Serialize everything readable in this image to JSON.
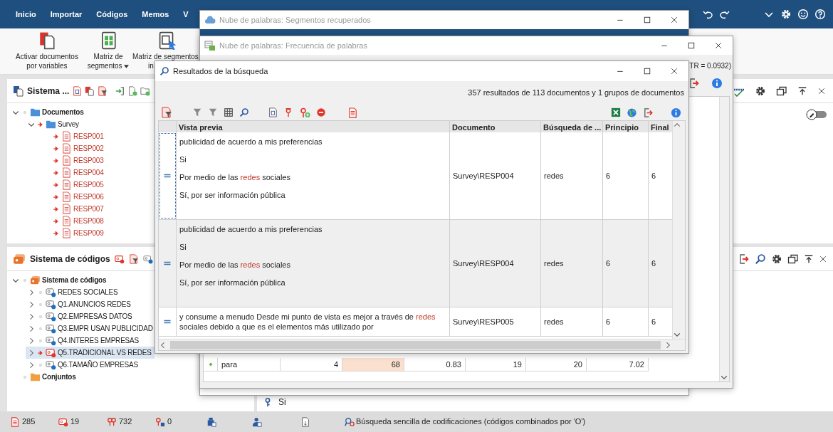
{
  "menu_tabs": [
    {
      "label": "Inicio",
      "selected": false
    },
    {
      "label": "Importar",
      "selected": false
    },
    {
      "label": "Códigos",
      "selected": false
    },
    {
      "label": "Memos",
      "selected": false
    },
    {
      "label": "V",
      "selected": false
    }
  ],
  "ribbon": [
    {
      "kind": "activate",
      "lines": [
        "Activar documentos",
        "por variables"
      ],
      "dropdown": false
    },
    {
      "kind": "matrix",
      "lines": [
        "Matriz de",
        "segmentos"
      ],
      "dropdown": true
    },
    {
      "kind": "matrix-cursor",
      "lines": [
        "Matriz de segmentos",
        "in"
      ],
      "dropdown": false
    }
  ],
  "document_panel": {
    "title": "Sistema ...",
    "tree": [
      {
        "label": "Documentos",
        "kind": "folder",
        "expanded": true,
        "activated": false,
        "children": [
          {
            "label": "Survey",
            "kind": "folder",
            "expanded": true,
            "activated": true,
            "children": [
              {
                "label": "RESP001",
                "kind": "doc",
                "activated": true
              },
              {
                "label": "RESP002",
                "kind": "doc",
                "activated": true
              },
              {
                "label": "RESP003",
                "kind": "doc",
                "activated": true
              },
              {
                "label": "RESP004",
                "kind": "doc",
                "activated": true
              },
              {
                "label": "RESP005",
                "kind": "doc",
                "activated": true
              },
              {
                "label": "RESP006",
                "kind": "doc",
                "activated": true
              },
              {
                "label": "RESP007",
                "kind": "doc",
                "activated": true
              },
              {
                "label": "RESP008",
                "kind": "doc",
                "activated": true
              },
              {
                "label": "RESP009",
                "kind": "doc",
                "activated": true
              }
            ]
          }
        ]
      }
    ]
  },
  "code_panel": {
    "title": "Sistema de códigos",
    "tree": [
      {
        "label": "Sistema de códigos",
        "kind": "root",
        "expanded": true,
        "activated": false,
        "selected": false,
        "children": [
          {
            "label": "REDES SOCIALES",
            "kind": "code",
            "expanded": false,
            "activated": false,
            "selected": false
          },
          {
            "label": "Q1.ANUNCIOS REDES",
            "kind": "code",
            "expanded": false,
            "activated": false,
            "selected": false
          },
          {
            "label": "Q2.EMPRESAS DATOS",
            "kind": "code",
            "expanded": false,
            "activated": false,
            "selected": false
          },
          {
            "label": "Q3.EMPR USAN PUBLICIDAD",
            "kind": "code",
            "expanded": false,
            "activated": false,
            "selected": false
          },
          {
            "label": "Q4.INTERES EMPRESAS",
            "kind": "code",
            "expanded": false,
            "activated": false,
            "selected": false
          },
          {
            "label": "Q5.TRADICIONAL VS REDES",
            "kind": "code",
            "expanded": false,
            "activated": true,
            "selected": true
          },
          {
            "label": "Q6.TAMAÑO EMPRESAS",
            "kind": "code",
            "expanded": false,
            "activated": false,
            "selected": false
          }
        ]
      },
      {
        "label": "Conjuntos",
        "kind": "sets",
        "activated": false,
        "selected": false
      }
    ]
  },
  "edit_toggle": {
    "on": false
  },
  "segment_panel": {
    "lines": [
      "Si"
    ]
  },
  "cloud_window": {
    "title": "Nube de palabras: Segmentos recuperados"
  },
  "frequency_window": {
    "title": "Nube de palabras: Frecuencia de palabras",
    "stat_text": "TR = 0.0932)",
    "rows": [
      {
        "word": "para",
        "cells": [
          "4",
          "68",
          "0.83",
          "19",
          "20",
          "7.02"
        ]
      }
    ]
  },
  "search_window": {
    "title": "Resultados de la búsqueda",
    "summary": "357 resultados de 113 documentos y 1 grupos de documentos",
    "columns": [
      "Vista previa",
      "Documento",
      "Búsqueda de ...",
      "Principio",
      "Final"
    ],
    "rows": [
      {
        "selected": true,
        "preview": [
          [
            {
              "text": "publicidad de acuerdo a mis preferencias"
            }
          ],
          [
            {
              "text": "Si"
            }
          ],
          [
            {
              "text": "Por medio de las "
            },
            {
              "text": "redes",
              "hit": true
            },
            {
              "text": " sociales"
            }
          ],
          [
            {
              "text": "Sí, por ser información pública"
            }
          ]
        ],
        "document": "Survey\\RESP004",
        "search": "redes",
        "start": "6",
        "end": "6"
      },
      {
        "selected": false,
        "preview": [
          [
            {
              "text": "publicidad de acuerdo a mis preferencias"
            }
          ],
          [
            {
              "text": "Si"
            }
          ],
          [
            {
              "text": "Por medio de las "
            },
            {
              "text": "redes",
              "hit": true
            },
            {
              "text": " sociales"
            }
          ],
          [
            {
              "text": "Sí, por ser información pública"
            }
          ]
        ],
        "document": "Survey\\RESP004",
        "search": "redes",
        "start": "6",
        "end": "6"
      },
      {
        "selected": false,
        "preview": [
          [
            {
              "text": "y consume a menudo  Desde mi punto de vista es mejor a través de "
            },
            {
              "text": "redes",
              "hit": true
            },
            {
              "text": " sociales debido a que es el elementos más utilizado por"
            }
          ]
        ],
        "document": "Survey\\RESP005",
        "search": "redes",
        "start": "6",
        "end": "6"
      }
    ]
  },
  "status_bar": {
    "counts": [
      {
        "kind": "documents",
        "text": "285"
      },
      {
        "kind": "codes",
        "text": "19"
      },
      {
        "kind": "segments",
        "text": "732"
      },
      {
        "kind": "memos",
        "text": "0"
      }
    ],
    "message": "Búsqueda sencilla de codificaciones (códigos combinados por 'O')"
  }
}
